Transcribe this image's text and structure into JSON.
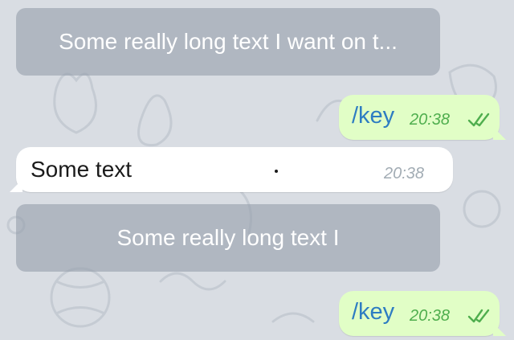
{
  "chat": {
    "keyboard_button_1": "Some really long text I want on t...",
    "outgoing_1": {
      "text": "/key",
      "time": "20:38",
      "status_icon": "double-check-icon"
    },
    "incoming_1": {
      "text": "Some text",
      "time": "20:38"
    },
    "keyboard_button_2": "Some really long text I",
    "outgoing_2": {
      "text": "/key",
      "time": "20:38",
      "status_icon": "double-check-icon"
    }
  },
  "colors": {
    "background": "#d9dde3",
    "keyboard_button": "#9aa3ae",
    "outgoing_bubble": "#e1fec6",
    "outgoing_text": "#2d7cc2",
    "outgoing_time": "#4fae4e",
    "incoming_bubble": "#ffffff",
    "incoming_time": "#a2acb4"
  }
}
